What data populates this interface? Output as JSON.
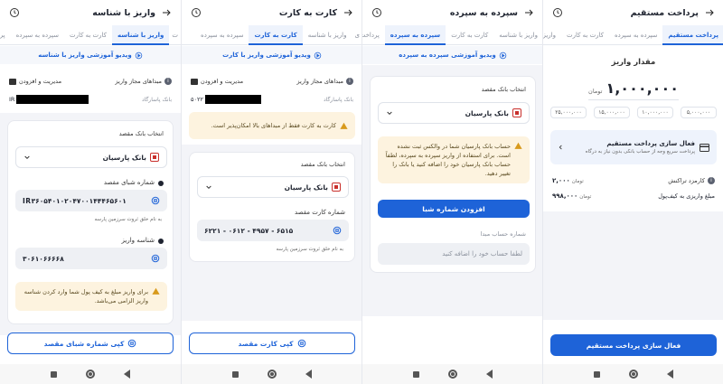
{
  "colors": {
    "accent": "#1e63d8",
    "warning_bg": "#fdf3df",
    "text": "#1f2430"
  },
  "icons": [
    "history-icon",
    "back-arrow-icon",
    "play-circle-icon",
    "info-icon",
    "wallet-icon",
    "bank-logo-icon",
    "chevron-down-icon",
    "copy-icon",
    "warning-icon",
    "chevron-left-icon",
    "card-icon"
  ],
  "screens": {
    "sheba": {
      "title": "واریز با شناسه",
      "tabs": [
        "واریز با شناسه",
        "کارت به کارت",
        "سپرده به سپرده",
        "پرداخ"
      ],
      "tab_first": "ت",
      "video": "ویدیو آموزشی واریز با شناسه",
      "allowed_label": "مبداهای مجاز واریز",
      "wallet_label": "مدیریت و افزودن",
      "bank_name_small": "بانک پاسارگاد",
      "iban_prefix": "IR",
      "select_label": "انتخاب بانک مقصد",
      "bank": "بانک پارسیان",
      "sheba_label": "شماره شبای مقصد",
      "sheba_value": "IR۳۶۰۵۴۰۱۰۲۰۴۷۰۰۱۴۴۴۶۵۶۰۱",
      "owner_note": "به نام خلق ثروت سرزمین پارسه",
      "id_label": "شناسه واریز",
      "id_value": "۳۰۶۱۰۶۶۶۶۸",
      "warning": "برای واریز مبلغ به کیف پول شما وارد کردن شناسه واریز الزامی می‌باشد.",
      "button": "کپی شماره شبای مقصد"
    },
    "card": {
      "title": "کارت به کارت",
      "tabs": [
        "سپرده به سپرده",
        "کارت به کارت",
        "واریز با شناسه"
      ],
      "tab_first": "ی",
      "video": "ویدیو آموزشی واریز با کارت",
      "allowed_label": "مبداهای مجاز واریز",
      "wallet_label": "مدیریت و افزودن",
      "bank_name_small": "بانک پاسارگاد",
      "card_prefix": "۵۰۲۲",
      "warning": "کارت به کارت فقط از مبداهای بالا امکان‌پذیر است.",
      "select_label": "انتخاب بانک مقصد",
      "bank": "بانک پارسیان",
      "card_label": "شماره کارت مقصد",
      "card_value": "۶۲۲۱ - ۰۶۱۲ - ۴۹۵۷ - ۶۵۱۵",
      "owner_note": "به نام خلق ثروت سرزمین پارسه",
      "button": "کپی کارت مقصد"
    },
    "deposit": {
      "title": "سپرده به سپرده",
      "tabs": [
        "پرداخت",
        "سپرده به سپرده",
        "کارت به کارت",
        "واریز با شناسه"
      ],
      "video": "ویدیو آموزشی سپرده به سپرده",
      "select_label": "انتخاب بانک مقصد",
      "bank": "بانک پارسیان",
      "warning": "حساب بانک پارسیان شما در والکس ثبت نشده است. برای استفاده از واریز سپرده به سپرده، لطفاً حساب بانک پارسیان خود را اضافه کنید یا بانک را تغییر دهید.",
      "add_button": "افزودن شماره شبا",
      "account_label": "شماره حساب مبدا",
      "account_placeholder": "لطفا حساب خود را اضافه کنید"
    },
    "direct": {
      "title": "پرداخت مستقیم",
      "tabs": [
        "پرداخت مستقیم",
        "سپرده به سپرده",
        "کارت به کارت",
        "واریز"
      ],
      "amount_label": "مقدار واریز",
      "amount_value": "۱,۰۰۰,۰۰۰",
      "currency": "تومان",
      "chips": [
        "۵,۰۰۰,۰۰۰",
        "۱۰,۰۰۰,۰۰۰",
        "۱۵,۰۰۰,۰۰۰",
        "۲۵,۰۰۰,۰۰۰"
      ],
      "activate_title": "فعال سازی پرداخت مستقیم",
      "activate_sub": "پرداخت سریع وجه از حساب بانکی بدون نیاز به درگاه",
      "fee_label": "کارمزد تراکنش",
      "fee_value": "۲,۰۰۰",
      "net_label": "مبلغ واریزی به کیف‌پول",
      "net_value": "۹۹۸,۰۰۰",
      "toman": "تومان",
      "button": "فعال سازی پرداخت مستقیم"
    }
  }
}
